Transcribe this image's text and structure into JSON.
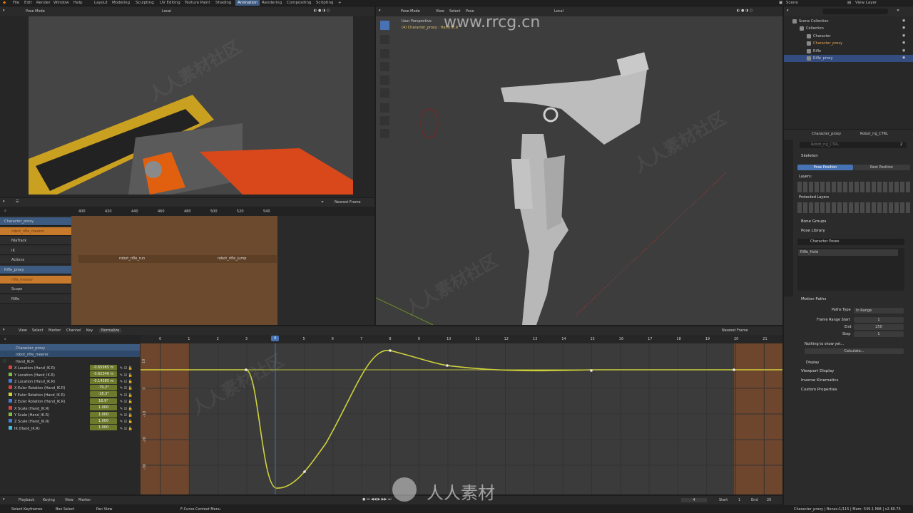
{
  "topbar": {
    "menus": [
      "File",
      "Edit",
      "Render",
      "Window",
      "Help"
    ],
    "workspaces": [
      "Layout",
      "Modeling",
      "Sculpting",
      "UV Editing",
      "Texture Paint",
      "Shading",
      "Animation",
      "Rendering",
      "Compositing",
      "Scripting"
    ],
    "active_workspace": "Animation",
    "scene": "Scene",
    "view_layer": "View Layer"
  },
  "camera_view": {
    "mode": "Pose Mode",
    "orientation": "Local"
  },
  "viewport": {
    "mode": "Pose Mode",
    "menus": [
      "View",
      "Select",
      "Pose"
    ],
    "title": "User Perspective",
    "subtitle": "(4) Character_proxy : Hand IK.R",
    "orientation": "Local",
    "watermark_url": "www.rrcg.cn"
  },
  "nla": {
    "ruler": [
      "400",
      "420",
      "440",
      "460",
      "480",
      "500",
      "520",
      "540"
    ],
    "snap": "Nearest Frame",
    "tracks": [
      {
        "label": "Character_proxy",
        "type": "object"
      },
      {
        "label": "robot_rifle_meerer",
        "type": "action"
      },
      {
        "label": "NlaTrack",
        "type": "track"
      },
      {
        "label": "IK",
        "type": "track"
      },
      {
        "label": "Actions",
        "type": "track"
      },
      {
        "label": "Rifle_proxy",
        "type": "object"
      },
      {
        "label": "rifle_meerer",
        "type": "action"
      },
      {
        "label": "Scope",
        "type": "track"
      },
      {
        "label": "Rifle",
        "type": "track"
      }
    ],
    "strips": [
      "robot_rifle_run",
      "robot_rifle_jump"
    ]
  },
  "graph": {
    "menus": [
      "View",
      "Select",
      "Marker",
      "Channel",
      "Key"
    ],
    "normalize": "Normalize",
    "snap": "Nearest Frame",
    "ruler": [
      "0",
      "1",
      "2",
      "3",
      "4",
      "5",
      "6",
      "7",
      "8",
      "9",
      "10",
      "11",
      "12",
      "13",
      "14",
      "15",
      "16",
      "17",
      "18",
      "19",
      "20",
      "21"
    ],
    "current_frame": "4",
    "y_labels": [
      "10",
      "0",
      "-10",
      "-20",
      "-30"
    ],
    "channels": [
      {
        "label": "Character_proxy",
        "color": "#3d5a80",
        "value": ""
      },
      {
        "label": "robot_rifle_meerer",
        "color": "#2f4a6a",
        "value": ""
      },
      {
        "label": "Hand_IK.R",
        "color": "#2b3b2b",
        "value": ""
      },
      {
        "label": "X Location (Hand_IK.R)",
        "color": "#d94040",
        "value": "-0.65965 m"
      },
      {
        "label": "Y Location (Hand_IK.R)",
        "color": "#7fbf3f",
        "value": "-0.62346 m"
      },
      {
        "label": "Z Location (Hand_IK.R)",
        "color": "#3f7fdf",
        "value": "-0.14385 m"
      },
      {
        "label": "X Euler Rotation (Hand_IK.R)",
        "color": "#d94040",
        "value": "-79.2°"
      },
      {
        "label": "Y Euler Rotation (Hand_IK.R)",
        "color": "#cfd13a",
        "value": "-18.3°"
      },
      {
        "label": "Z Euler Rotation (Hand_IK.R)",
        "color": "#3f7fdf",
        "value": "16.9°"
      },
      {
        "label": "X Scale (Hand_IK.R)",
        "color": "#d94040",
        "value": "1.000"
      },
      {
        "label": "Y Scale (Hand_IK.R)",
        "color": "#7fbf3f",
        "value": "1.000"
      },
      {
        "label": "Z Scale (Hand_IK.R)",
        "color": "#3f7fdf",
        "value": "1.000"
      },
      {
        "label": "IK (Hand_IK.R)",
        "color": "#3fbfdf",
        "value": "1.000"
      }
    ]
  },
  "timeline": {
    "menus": [
      "Playback",
      "Keying",
      "View",
      "Marker"
    ],
    "current": "4",
    "start_label": "Start",
    "start": "1",
    "end_label": "End",
    "end": "20"
  },
  "statusbar": {
    "left": [
      "Select Keyframes",
      "Box Select",
      "Pan View",
      "F-Curve Context Menu"
    ],
    "right": "Character_proxy | Bones:1/115 | Mem: 539.1 MiB | v2.80.75"
  },
  "outliner": {
    "search_placeholder": "",
    "items": [
      {
        "label": "Scene Collection",
        "indent": 0
      },
      {
        "label": "Collection",
        "indent": 1
      },
      {
        "label": "Character",
        "indent": 2
      },
      {
        "label": "Character_proxy",
        "indent": 2
      },
      {
        "label": "Rifle",
        "indent": 2
      },
      {
        "label": "Rifle_proxy",
        "indent": 2
      }
    ]
  },
  "properties": {
    "breadcrumb_a": "Character_proxy",
    "breadcrumb_b": "Robot_rig_CTRL",
    "datablock": "Robot_rig_CTRL",
    "datablock_users": "2",
    "skeleton": "Skeleton",
    "pose_position": "Pose Position",
    "rest_position": "Rest Position",
    "layers": "Layers:",
    "protected_layers": "Protected Layers",
    "bone_groups": "Bone Groups",
    "pose_library": "Pose Library",
    "pose_lib_name": "Character Poses",
    "pose_item": "Rifle_Hold",
    "motion_paths": "Motion Paths",
    "paths_type_label": "Paths Type",
    "paths_type": "In Range",
    "frame_range_start_label": "Frame Range Start",
    "frame_range_start": "1",
    "end_label": "End",
    "end": "250",
    "step_label": "Step",
    "step": "1",
    "nothing_msg": "Nothing to show yet...",
    "calculate": "Calculate...",
    "display": "Display",
    "viewport_display": "Viewport Display",
    "inverse_kinematics": "Inverse Kinematics",
    "custom_properties": "Custom Properties"
  },
  "watermarks": [
    "人人素材社区",
    "人人素材"
  ]
}
